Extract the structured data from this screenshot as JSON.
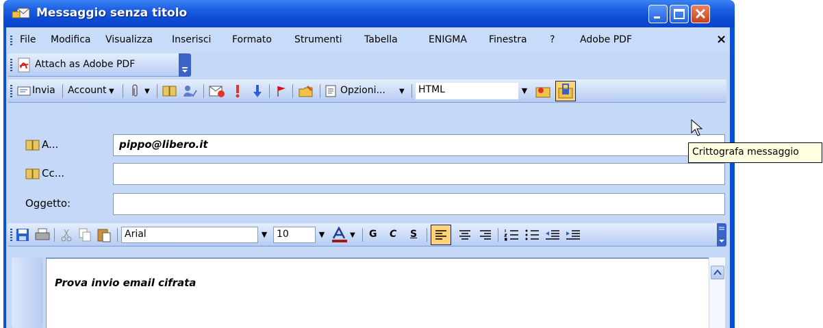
{
  "window": {
    "title": "Messaggio senza titolo"
  },
  "menu": [
    "File",
    "Modifica",
    "Visualizza",
    "Inserisci",
    "Formato",
    "Strumenti",
    "Tabella",
    "ENIGMA",
    "Finestra",
    "?",
    "Adobe PDF"
  ],
  "menu_close": "×",
  "pdf_toolbar": {
    "attach_label": "Attach as Adobe PDF"
  },
  "send_toolbar": {
    "send_label": "Invia",
    "account_label": "Account",
    "options_label": "Opzioni...",
    "format_value": "HTML"
  },
  "header": {
    "to_label": "A...",
    "to_value": "pippo@libero.it",
    "cc_label": "Cc...",
    "cc_value": "",
    "subject_label": "Oggetto:",
    "subject_value": ""
  },
  "format_toolbar": {
    "font_value": "Arial",
    "size_value": "10",
    "bold_label": "G",
    "italic_label": "C",
    "underline_label": "S"
  },
  "body": {
    "text": "Prova invio email cifrata"
  },
  "tooltip": "Crittografa messaggio",
  "colors": {
    "title_blue": "#0a4fd6",
    "toolbar_light": "#e4eefc",
    "highlight": "#ffd27a"
  }
}
